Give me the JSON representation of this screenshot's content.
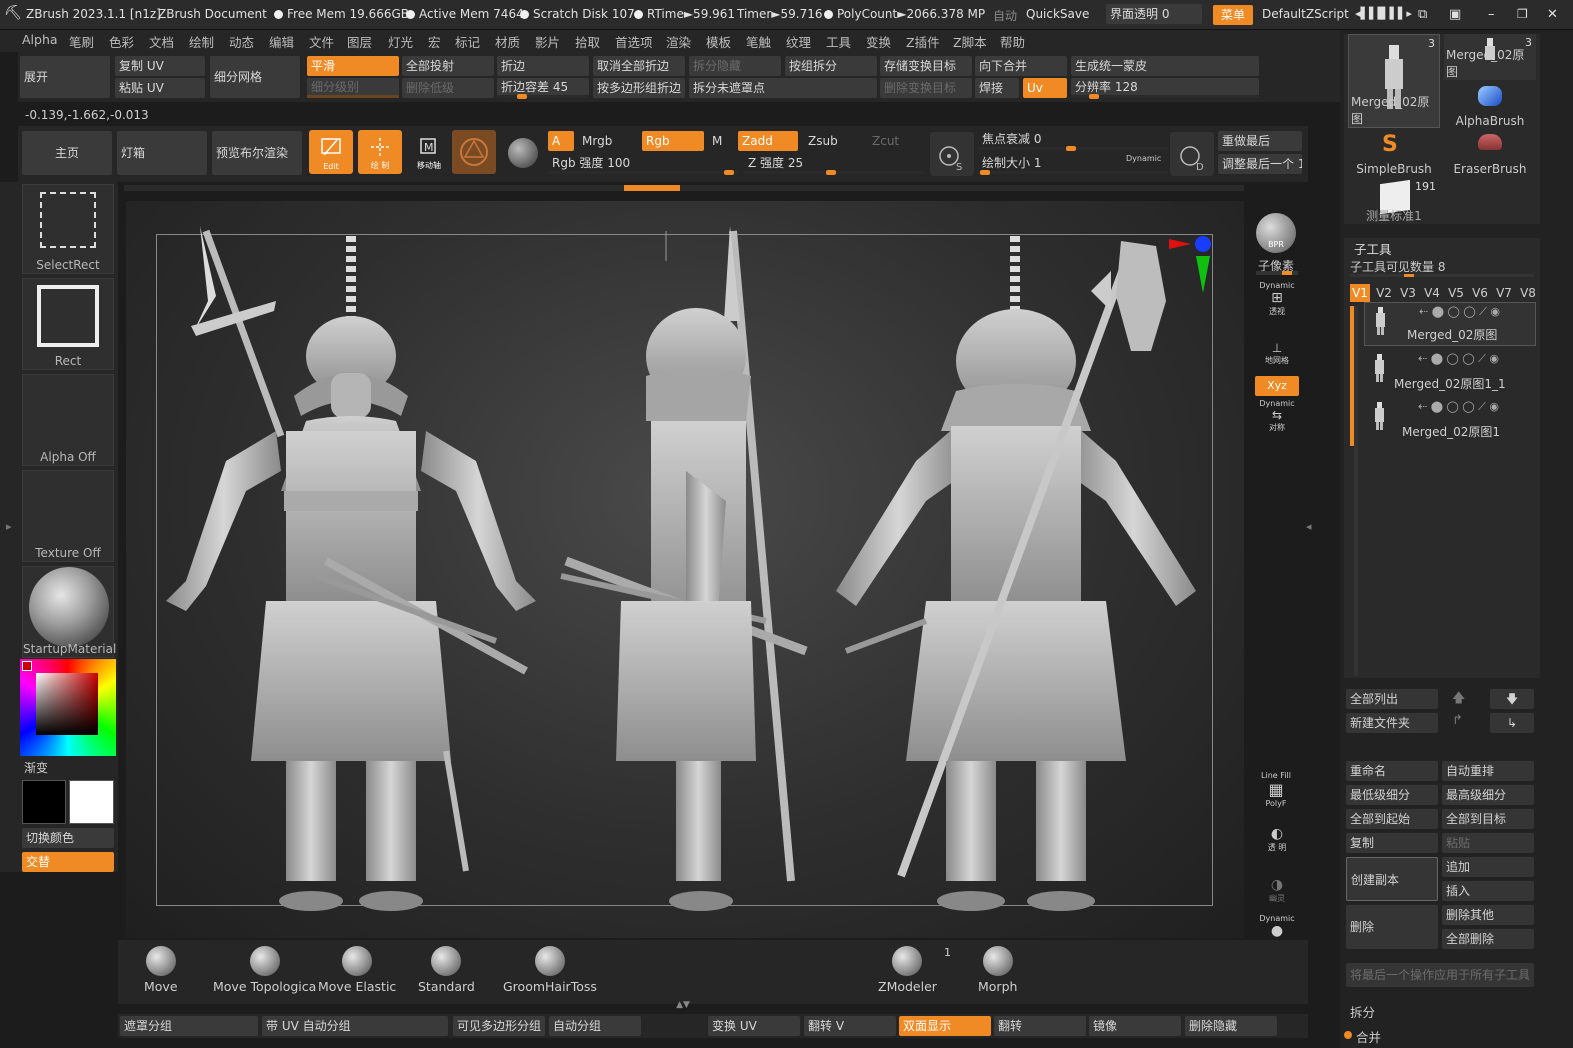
{
  "titlebar": {
    "app": "ZBrush 2023.1.1 [n1z]",
    "doc": "ZBrush Document",
    "free_mem": "Free Mem 19.666GB",
    "active_mem": "Active Mem 7464",
    "scratch": "Scratch Disk 107",
    "rtime": "RTime►59.961",
    "timer": "Timer►59.716",
    "polycount": "PolyCount►2066.378 MP",
    "autosave": "自动",
    "quicksave": "QuickSave",
    "transparency": "界面透明 0",
    "menu_btn": "菜单",
    "script": "DefaultZScript"
  },
  "menubar": [
    "Alpha",
    "笔刷",
    "色彩",
    "文档",
    "绘制",
    "动态",
    "编辑",
    "文件",
    "图层",
    "灯光",
    "宏",
    "标记",
    "材质",
    "影片",
    "拾取",
    "首选项",
    "渲染",
    "模板",
    "笔触",
    "纹理",
    "工具",
    "变换",
    "Z插件",
    "Z脚本",
    "帮助"
  ],
  "subpalette": {
    "unfold": "展开",
    "copy_uv": "复制 UV",
    "paste_uv": "粘贴 UV",
    "subdivide": "细分网格",
    "smooth": "平滑",
    "subdiv_level": "细分级别",
    "del_lower": "删除低级",
    "project_all": "全部投射",
    "crease": "折边",
    "crease_tol": "折边容差 45",
    "uncrease_all": "取消全部折边",
    "split_hidden": "拆分隐藏",
    "crease_pg": "按多边形组折边",
    "split_unmasked": "拆分未遮罩点",
    "group_split": "按组拆分",
    "store_morph": "存储变换目标",
    "del_morph": "删除变换目标",
    "merge_down": "向下合并",
    "weld": "焊接",
    "uv_btn": "Uv",
    "unified_skin": "生成统一蒙皮",
    "resolution": "分辨率 128",
    "coords": "-0.139,-1.662,-0.013"
  },
  "toolbar": {
    "home": "主页",
    "lightbox": "灯箱",
    "bpr_preview": "预览布尔渲染",
    "edit": "Edit",
    "draw": "绘 制",
    "move": "移动轴",
    "a": "A",
    "mrgb": "Mrgb",
    "rgb": "Rgb",
    "m": "M",
    "zadd": "Zadd",
    "zsub": "Zsub",
    "zcut": "Zcut",
    "rgb_intensity": "Rgb 强度 100",
    "z_intensity": "Z 强度 25",
    "focal_shift": "焦点衰减 0",
    "draw_size": "绘制大小 1",
    "dynamic": "Dynamic",
    "redo_last": "重做最后",
    "adjust_last": "调整最后一个 1"
  },
  "left": {
    "selectrect": "SelectRect",
    "rect": "Rect",
    "alpha_off": "Alpha Off",
    "texture_off": "Texture Off",
    "material": "StartupMaterial",
    "gradient": "渐变",
    "switch_color": "切换颜色",
    "alternate": "交替"
  },
  "rightshelf": {
    "bpr": "BPR",
    "subpixel": "子像素",
    "dynamic": "Dynamic",
    "persp": "透视",
    "floor": "地网格",
    "xyz": "Xyz",
    "sym": "对称",
    "linefill": "Line Fill",
    "polyf": "PolyF",
    "transp": "透 明",
    "ghost": "幽灵",
    "solo": "孤立"
  },
  "brushes": [
    {
      "name": "Move"
    },
    {
      "name": "Move Topologica"
    },
    {
      "name": "Move Elastic"
    },
    {
      "name": "Standard"
    },
    {
      "name": "GroomHairToss"
    },
    {
      "name": "ZModeler",
      "badge": "1"
    },
    {
      "name": "Morph"
    }
  ],
  "bottombar": [
    "遮罩分组",
    "带 UV 自动分组",
    "可见多边形分组",
    "自动分组",
    "变换 UV",
    "翻转 V",
    "双面显示",
    "翻转",
    "镜像",
    "删除隐藏"
  ],
  "tools": [
    {
      "name": "Merged_02原图",
      "count": "3"
    },
    {
      "name": "Merged_02原图",
      "count": "3"
    },
    {
      "name": "AlphaBrush"
    },
    {
      "name": "SimpleBrush"
    },
    {
      "name": "EraserBrush"
    },
    {
      "name": "测量标准1",
      "count": "191"
    }
  ],
  "subtool": {
    "header": "子工具",
    "visible": "子工具可见数量 8",
    "tabs": [
      "V1",
      "V2",
      "V3",
      "V4",
      "V5",
      "V6",
      "V7",
      "V8"
    ],
    "items": [
      "Merged_02原图",
      "Merged_02原图1_1",
      "Merged_02原图1"
    ],
    "list_all": "全部列出",
    "new_folder": "新建文件夹",
    "rename": "重命名",
    "auto_reorder": "自动重排",
    "lowest_sub": "最低级细分",
    "highest_sub": "最高级细分",
    "all_to_start": "全部到起始",
    "all_to_target": "全部到目标",
    "copy": "复制",
    "paste": "粘贴",
    "create_copy": "创建副本",
    "append": "追加",
    "insert": "插入",
    "delete": "删除",
    "delete_other": "删除其他",
    "delete_all": "全部删除",
    "apply_all": "将最后一个操作应用于所有子工具",
    "split": "拆分",
    "merge": "合并"
  },
  "colors": {
    "accent": "#f08a24",
    "panel": "#2d2d2d",
    "bg": "#1c1c1c"
  }
}
